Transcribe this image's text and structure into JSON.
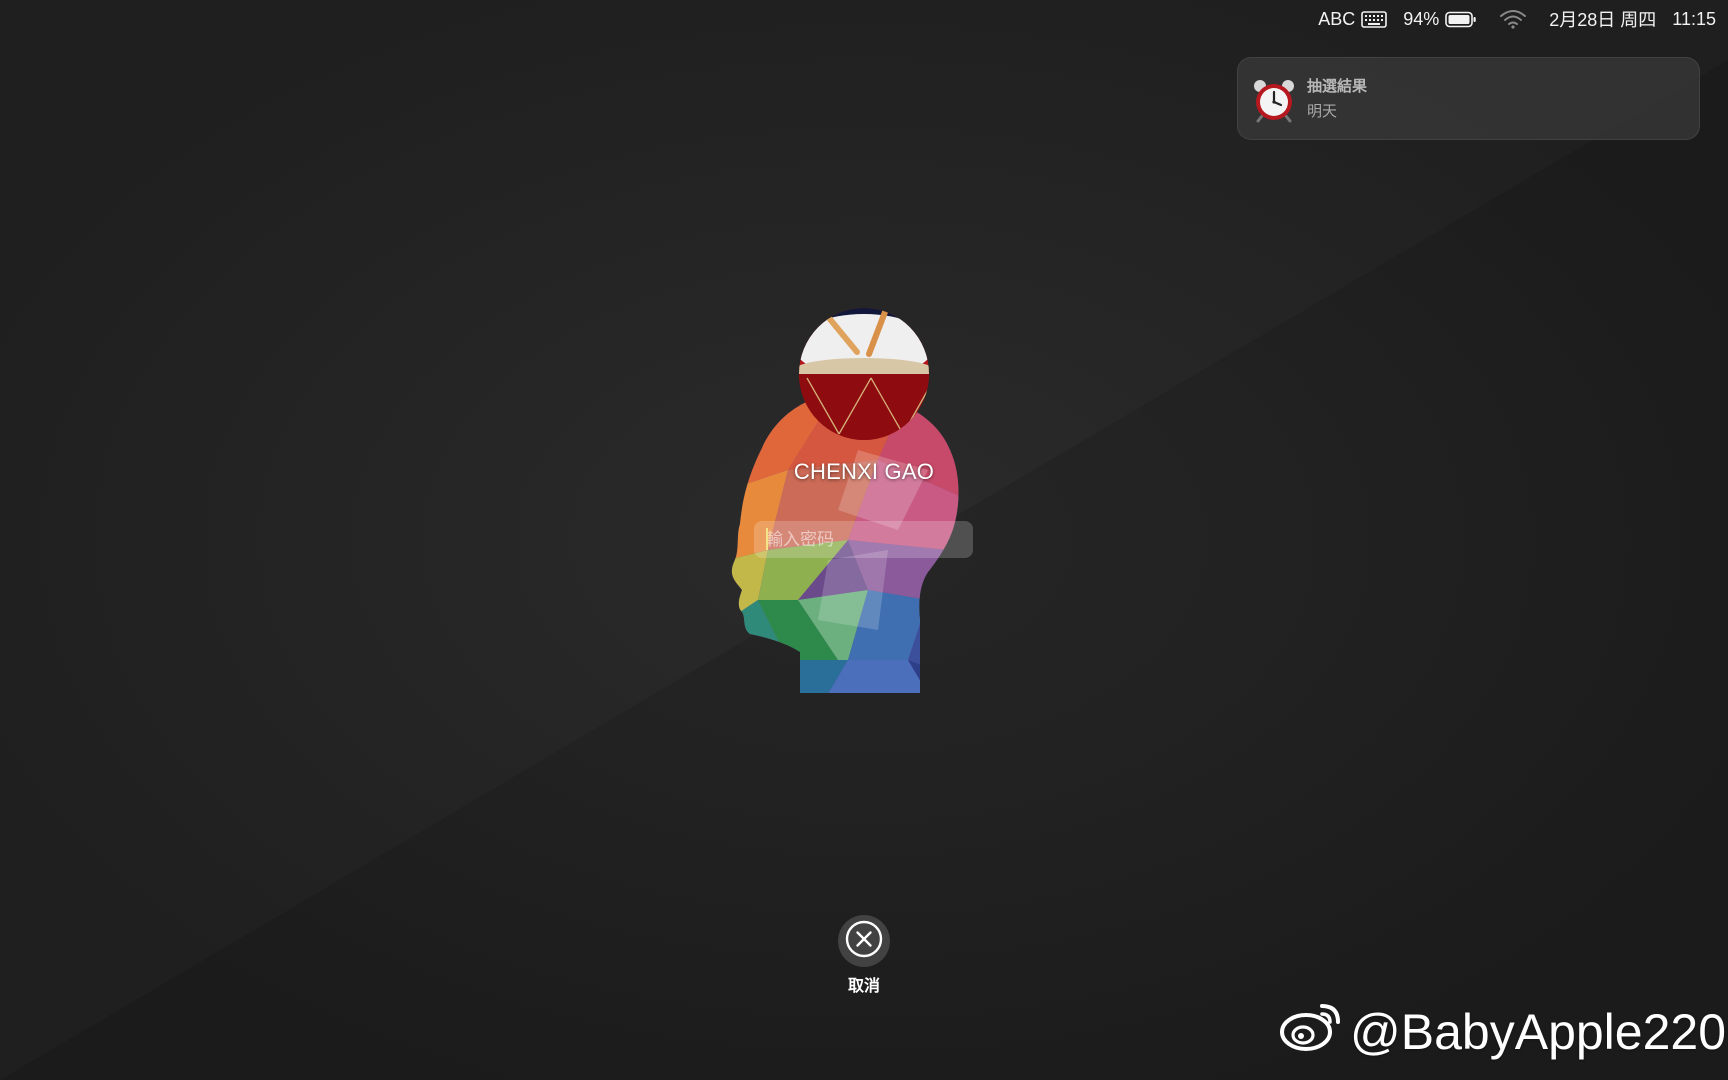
{
  "menubar": {
    "input_source": "ABC",
    "battery_percent": "94%",
    "date": "2月28日 周四",
    "time": "11:15",
    "icons": [
      "keyboard-icon",
      "battery-icon",
      "wifi-icon"
    ]
  },
  "notification": {
    "icon": "alarm-clock-icon",
    "title": "抽選結果",
    "body": "明天"
  },
  "login": {
    "username": "CHENXI GAO",
    "password_placeholder": "輸入密码",
    "password_value": ""
  },
  "cancel": {
    "icon": "close-circle-icon",
    "label": "取消"
  },
  "watermark": {
    "logo": "weibo-logo",
    "text": "@BabyApple220"
  }
}
